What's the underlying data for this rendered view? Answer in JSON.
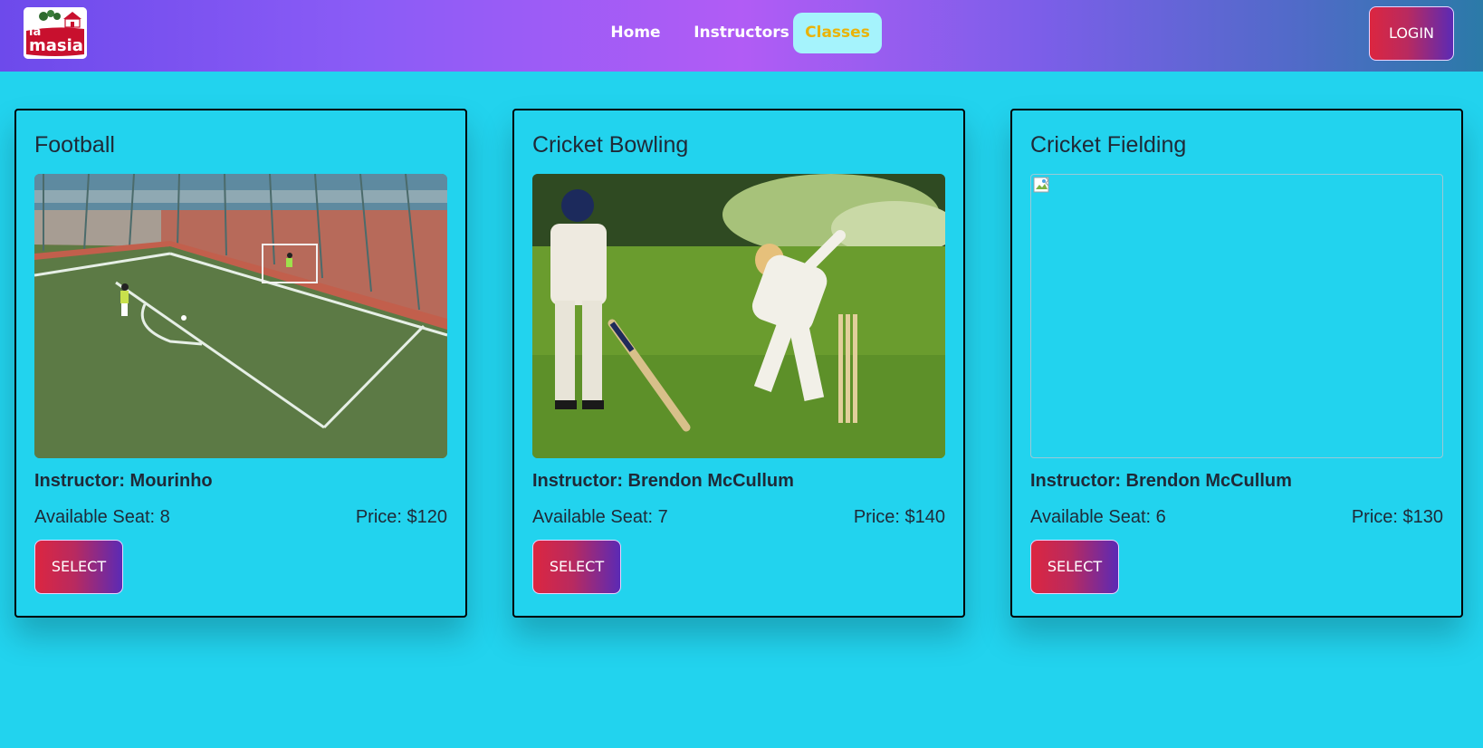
{
  "navbar": {
    "logo_text_top": "la",
    "logo_text_bottom": "masia",
    "links": [
      {
        "label": "Home"
      },
      {
        "label": "Instructors"
      },
      {
        "label": "Classes",
        "active": true
      }
    ],
    "login_label": "LOGIN"
  },
  "colors": {
    "page_background": "#22d3ee",
    "active_nav_bg": "#a5f3fc",
    "active_nav_text": "#eab308",
    "button_gradient_start": "#dc2640",
    "button_gradient_end": "#5b2ab5"
  },
  "classes": [
    {
      "title": "Football",
      "image": "football-pitch-photo",
      "instructor": "Instructor: Mourinho",
      "seats": "Available Seat: 8",
      "price": "Price: $120",
      "button": "SELECT"
    },
    {
      "title": "Cricket Bowling",
      "image": "cricket-bowling-photo",
      "instructor": "Instructor: Brendon McCullum",
      "seats": "Available Seat: 7",
      "price": "Price: $140",
      "button": "SELECT"
    },
    {
      "title": "Cricket Fielding",
      "image": "broken-image-icon",
      "instructor": "Instructor: Brendon McCullum",
      "seats": "Available Seat: 6",
      "price": "Price: $130",
      "button": "SELECT"
    }
  ]
}
